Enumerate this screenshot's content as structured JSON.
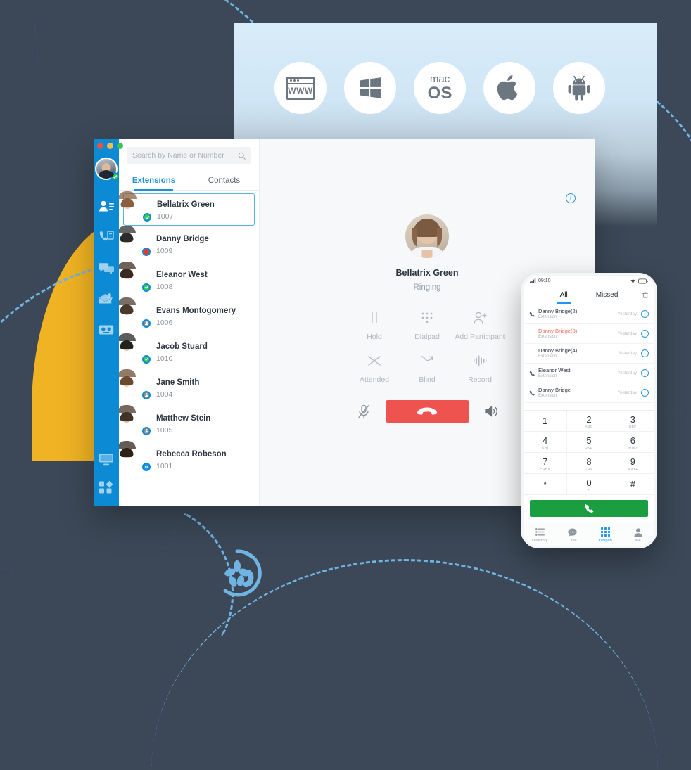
{
  "background": {
    "dark_color": "#3c4857",
    "accent_yellow": "#f0b323",
    "accent_blue": "#6fb4e2",
    "brand_logo_name": "yeastar-linkus-logo"
  },
  "platform_banner": {
    "icons": [
      {
        "name": "web-browser-icon",
        "label": "WWW"
      },
      {
        "name": "windows-icon",
        "label": "Windows"
      },
      {
        "name": "macos-icon",
        "label_line1": "mac",
        "label_line2": "OS"
      },
      {
        "name": "apple-icon",
        "label": "Apple iOS"
      },
      {
        "name": "android-icon",
        "label": "Android"
      }
    ]
  },
  "desktop_app": {
    "window_controls": [
      "close",
      "minimize",
      "maximize"
    ],
    "user_avatar": {
      "name": "user-avatar",
      "presence": "online"
    },
    "sidebar_items": [
      {
        "name": "sidebar-item-contacts",
        "label": "Contacts",
        "active": true
      },
      {
        "name": "sidebar-item-call-history",
        "label": "Call History",
        "active": false
      },
      {
        "name": "sidebar-item-chat",
        "label": "Chat",
        "active": false
      },
      {
        "name": "sidebar-item-voicemail",
        "label": "Voicemail",
        "active": false
      },
      {
        "name": "sidebar-item-recordings",
        "label": "Recordings",
        "active": false
      }
    ],
    "sidebar_bottom_items": [
      {
        "name": "sidebar-item-desktop",
        "label": "Desktop"
      },
      {
        "name": "sidebar-item-apps",
        "label": "Apps"
      }
    ],
    "search": {
      "placeholder": "Search by Name or Number",
      "value": ""
    },
    "tabs": [
      {
        "label": "Extensions",
        "active": true
      },
      {
        "label": "Contacts",
        "active": false
      }
    ],
    "contacts": [
      {
        "name": "Bellatrix Green",
        "ext": "1007",
        "presence": "online",
        "selected": true
      },
      {
        "name": "Danny Bridge",
        "ext": "1009",
        "presence": "busy",
        "selected": false
      },
      {
        "name": "Eleanor West",
        "ext": "1008",
        "presence": "online",
        "selected": false
      },
      {
        "name": "Evans Montogomery",
        "ext": "1006",
        "presence": "away",
        "selected": false
      },
      {
        "name": "Jacob Stuard",
        "ext": "1010",
        "presence": "online",
        "selected": false
      },
      {
        "name": "Jane Smith",
        "ext": "1004",
        "presence": "away",
        "selected": false
      },
      {
        "name": "Matthew Stein",
        "ext": "1005",
        "presence": "away",
        "selected": false
      },
      {
        "name": "Rebecca Robeson",
        "ext": "1001",
        "presence": "hold",
        "selected": false
      }
    ],
    "call_panel": {
      "info_label": "i",
      "callee_name": "Bellatrix Green",
      "call_status": "Ringing",
      "controls": [
        {
          "name": "hold-button",
          "label": "Hold",
          "icon": "pause-icon"
        },
        {
          "name": "dialpad-button",
          "label": "Dialpad",
          "icon": "dialpad-icon"
        },
        {
          "name": "add-participant-button",
          "label": "Add Participant",
          "icon": "person-add-icon"
        },
        {
          "name": "attended-transfer-button",
          "label": "Attended",
          "icon": "attended-transfer-icon"
        },
        {
          "name": "blind-transfer-button",
          "label": "Blind",
          "icon": "blind-transfer-icon"
        },
        {
          "name": "record-button",
          "label": "Record",
          "icon": "record-waveform-icon"
        }
      ],
      "mute_icon": "mic-muted-icon",
      "hangup_icon": "hangup-icon",
      "speaker_icon": "speaker-icon"
    }
  },
  "mobile_app": {
    "status_bar": {
      "time": "09:10",
      "signal_icon": "signal-bars-icon",
      "wifi_icon": "wifi-icon",
      "battery_icon": "battery-icon"
    },
    "tabs": [
      {
        "label": "All",
        "active": true
      },
      {
        "label": "Missed",
        "active": false
      }
    ],
    "delete_icon": "trash-icon",
    "call_logs": [
      {
        "name": "Danny Bridge(2)",
        "sub": "Extension",
        "time": "Yesterday",
        "missed": false,
        "has_call_icon": true
      },
      {
        "name": "Danny Bridge(3)",
        "sub": "Extension",
        "time": "Yesterday",
        "missed": true,
        "has_call_icon": false
      },
      {
        "name": "Danny Bridge(4)",
        "sub": "Extension",
        "time": "Yesterday",
        "missed": false,
        "has_call_icon": false
      },
      {
        "name": "Eleanor West",
        "sub": "Extension",
        "time": "Yesterday",
        "missed": false,
        "has_call_icon": true
      },
      {
        "name": "Danny Bridge",
        "sub": "Extension",
        "time": "Yesterday",
        "missed": false,
        "has_call_icon": true
      }
    ],
    "dialpad": [
      [
        {
          "num": "1",
          "sub": ""
        },
        {
          "num": "2",
          "sub": "ABC"
        },
        {
          "num": "3",
          "sub": "DEF"
        }
      ],
      [
        {
          "num": "4",
          "sub": "GHI"
        },
        {
          "num": "5",
          "sub": "JKL"
        },
        {
          "num": "6",
          "sub": "MNO"
        }
      ],
      [
        {
          "num": "7",
          "sub": "PQRS"
        },
        {
          "num": "8",
          "sub": "TUV"
        },
        {
          "num": "9",
          "sub": "WXYZ"
        }
      ],
      [
        {
          "num": "*",
          "sub": ""
        },
        {
          "num": "0",
          "sub": "+"
        },
        {
          "num": "#",
          "sub": ""
        }
      ]
    ],
    "call_button_icon": "phone-handset-icon",
    "nav_items": [
      {
        "label": "Directory",
        "icon": "list-icon",
        "active": false
      },
      {
        "label": "Chat",
        "icon": "chat-bubble-icon",
        "active": false
      },
      {
        "label": "Dialpad",
        "icon": "dialpad-grid-icon",
        "active": true
      },
      {
        "label": "Me",
        "icon": "person-icon",
        "active": false
      }
    ]
  }
}
